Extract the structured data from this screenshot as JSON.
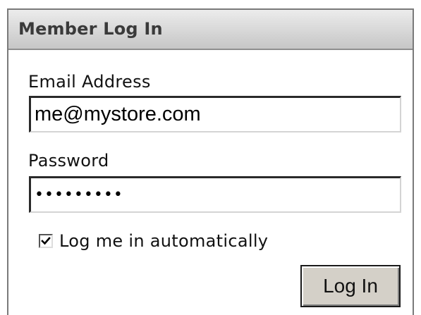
{
  "panel": {
    "title": "Member Log In"
  },
  "form": {
    "email": {
      "label": "Email Address",
      "value": "me@mystore.com"
    },
    "password": {
      "label": "Password",
      "value": "•••••••••"
    },
    "remember": {
      "label": "Log me in automatically",
      "checked": true
    },
    "submit_label": "Log In"
  },
  "icons": {
    "checkbox": "checkmark-icon"
  },
  "colors": {
    "header_gradient_top": "#ececec",
    "header_gradient_bottom": "#c6c6c6",
    "button_face": "#d4d0c8"
  }
}
